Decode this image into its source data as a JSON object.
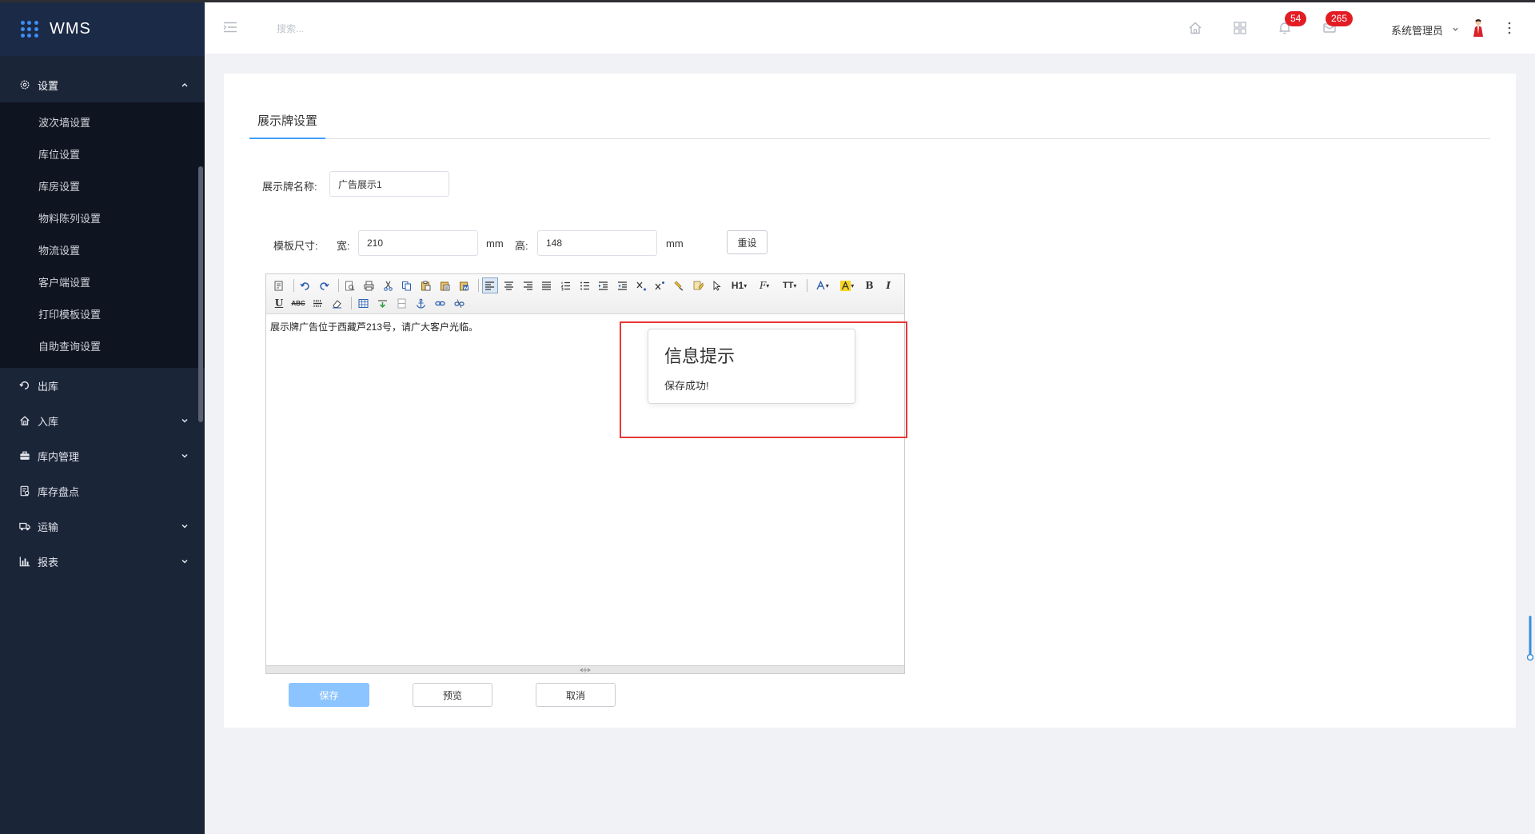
{
  "app": {
    "title": "WMS"
  },
  "sidebar": {
    "open_group": {
      "label": "设置",
      "items": [
        "波次墙设置",
        "库位设置",
        "库房设置",
        "物料陈列设置",
        "物流设置",
        "客户端设置",
        "打印模板设置",
        "自助查询设置"
      ]
    },
    "groups": [
      {
        "label": "出库",
        "icon": "outbound-icon",
        "expandable": false
      },
      {
        "label": "入库",
        "icon": "inbound-icon",
        "expandable": true
      },
      {
        "label": "库内管理",
        "icon": "warehouse-management-icon",
        "expandable": true
      },
      {
        "label": "库存盘点",
        "icon": "inventory-count-icon",
        "expandable": false
      },
      {
        "label": "运输",
        "icon": "truck-icon",
        "expandable": true
      },
      {
        "label": "报表",
        "icon": "bar-chart-icon",
        "expandable": true
      }
    ]
  },
  "header": {
    "search_placeholder": "搜索...",
    "notifications_count": "54",
    "messages_count": "265",
    "user_name": "系统管理员"
  },
  "page": {
    "tab_label": "展示牌设置",
    "form": {
      "name_label": "展示牌名称:",
      "name_value": "广告展示1",
      "size_label": "模板尺寸:",
      "width_label": "宽:",
      "width_value": "210",
      "height_label": "高:",
      "height_value": "148",
      "unit_width": "mm",
      "unit_height": "mm",
      "reset_button": "重设"
    },
    "editor": {
      "content": "展示牌广告位于西藏芦213号，请广大客户光临。",
      "heading_tool": "H1",
      "font_tool": "F",
      "size_tool": "TT",
      "bold_tool": "B",
      "italic_tool": "I",
      "underline_tool": "U",
      "strike_tool": "ABC"
    },
    "buttons": {
      "save": "保存",
      "preview": "预览",
      "cancel": "取消"
    },
    "message": {
      "title": "信息提示",
      "text": "保存成功!"
    }
  },
  "colors": {
    "sidebar_bg": "#1b2538",
    "brand_bg": "#1b2a46",
    "accent": "#409eff",
    "save_button": "#8cc4ff",
    "badge": "#e31c24",
    "highlight_frame": "#e53935"
  }
}
